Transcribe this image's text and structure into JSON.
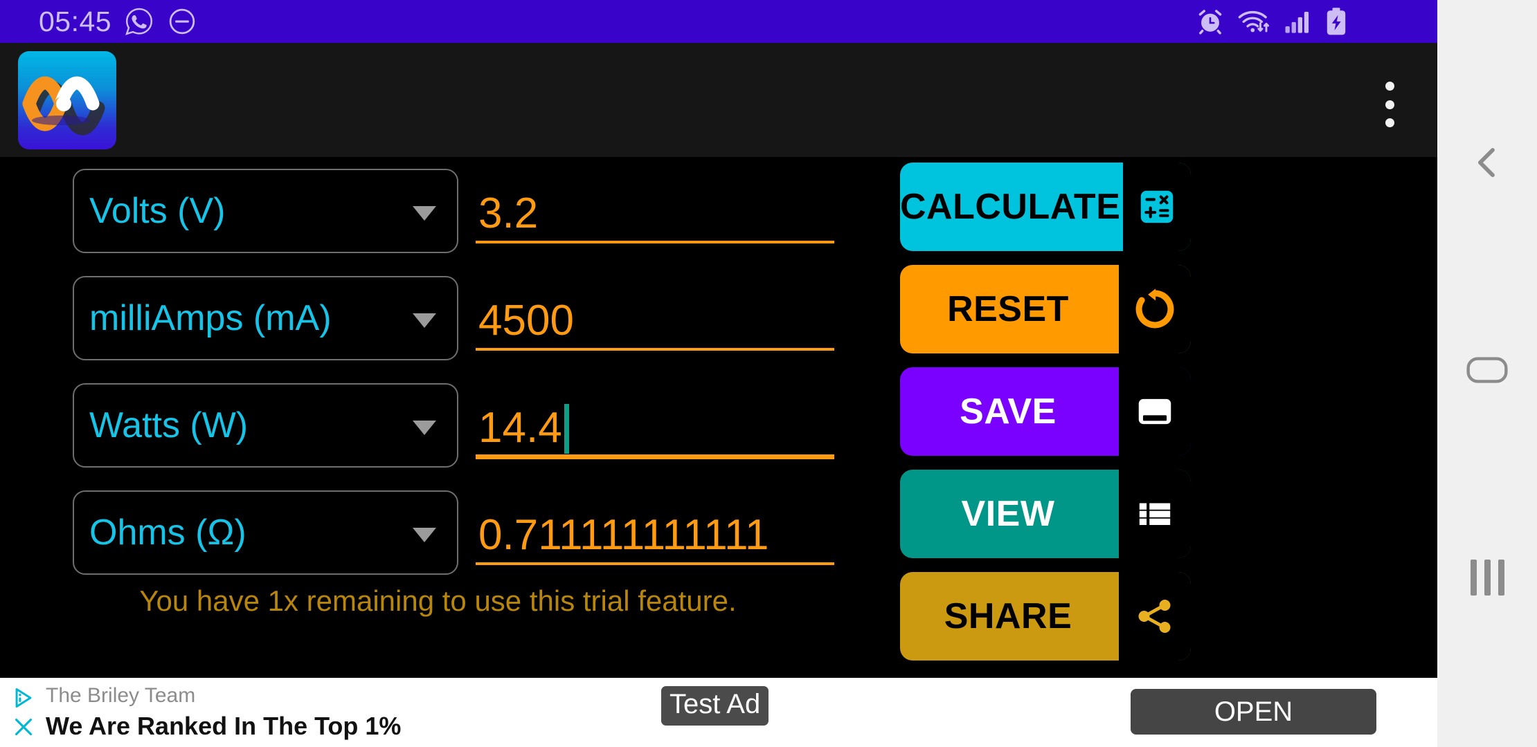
{
  "status_bar": {
    "time": "05:45",
    "left_icons": [
      "whatsapp-icon",
      "do-not-disturb-icon"
    ],
    "right_icons": [
      "alarm-icon",
      "wifi-icon",
      "signal-icon",
      "battery-charging-icon"
    ],
    "background_color": "#3A03C9"
  },
  "app_bar": {
    "logo_name": "app-logo-waveform",
    "overflow_menu_label": "More options"
  },
  "calculator": {
    "rows": [
      {
        "unit": "Volts (V)",
        "value": "3.2",
        "focused": false
      },
      {
        "unit": "milliAmps (mA)",
        "value": "4500",
        "focused": false
      },
      {
        "unit": "Watts (W)",
        "value": "14.4",
        "focused": true
      },
      {
        "unit": "Ohms (Ω)",
        "value": "0.711111111111",
        "focused": false
      }
    ],
    "trial_note": "You have 1x remaining to use this trial feature.",
    "unit_text_color": "#16C4E8",
    "value_text_color": "#FF9B13",
    "trial_note_color": "#B8860B",
    "cursor_color": "#0F9D86"
  },
  "actions": [
    {
      "label": "CALCULATE",
      "icon": "calculator-icon",
      "bg": "#00C3DE",
      "text_color": "#000000",
      "icon_color": "#00C3DE"
    },
    {
      "label": "RESET",
      "icon": "restore-icon",
      "bg": "#FF9B00",
      "text_color": "#000000",
      "icon_color": "#FF9B00"
    },
    {
      "label": "SAVE",
      "icon": "save-icon",
      "bg": "#7A00FF",
      "text_color": "#FFFFFF",
      "icon_color": "#FFFFFF"
    },
    {
      "label": "VIEW",
      "icon": "list-icon",
      "bg": "#009688",
      "text_color": "#FFFFFF",
      "icon_color": "#FFFFFF"
    },
    {
      "label": "SHARE",
      "icon": "share-icon",
      "bg": "#CC9A10",
      "text_color": "#000000",
      "icon_color": "#E8B020"
    }
  ],
  "ad": {
    "advertiser": "The Briley Team",
    "headline": "We Are Ranked In The Top 1%",
    "badge": "Test Ad",
    "cta": "OPEN",
    "accent_color": "#00B8D4"
  },
  "nav_bar": {
    "back_label": "Back",
    "home_label": "Home",
    "recents_label": "Recents",
    "background_color": "#F0F0F0"
  }
}
